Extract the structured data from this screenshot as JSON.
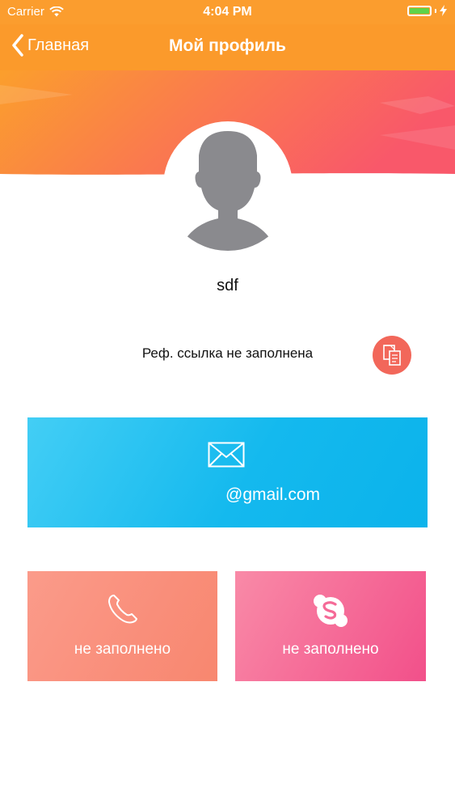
{
  "status_bar": {
    "carrier": "Carrier",
    "time": "4:04 PM",
    "wifi_icon": "wifi-icon",
    "battery_icon": "battery-icon",
    "charging_icon": "bolt-icon"
  },
  "nav": {
    "back_label": "Главная",
    "back_icon": "chevron-left-icon",
    "title": "Мой профиль"
  },
  "profile": {
    "avatar_icon": "person-silhouette-icon",
    "username": "sdf",
    "ref_text": "Реф. ссылка не заполнена",
    "copy_icon": "copy-icon"
  },
  "contacts": {
    "email": {
      "icon": "envelope-icon",
      "value": "@gmail.com"
    },
    "phone": {
      "icon": "phone-icon",
      "value": "не заполнено"
    },
    "skype": {
      "icon": "skype-icon",
      "value": "не заполнено"
    }
  },
  "colors": {
    "nav_orange": "#fb9a2b",
    "banner_orange": "#fb9f2c",
    "banner_red": "#f9586a",
    "email_blue": "#14b9ee",
    "phone_salmon": "#f98e7a",
    "skype_pink": "#f56a97",
    "copy_red": "#f2675a"
  }
}
